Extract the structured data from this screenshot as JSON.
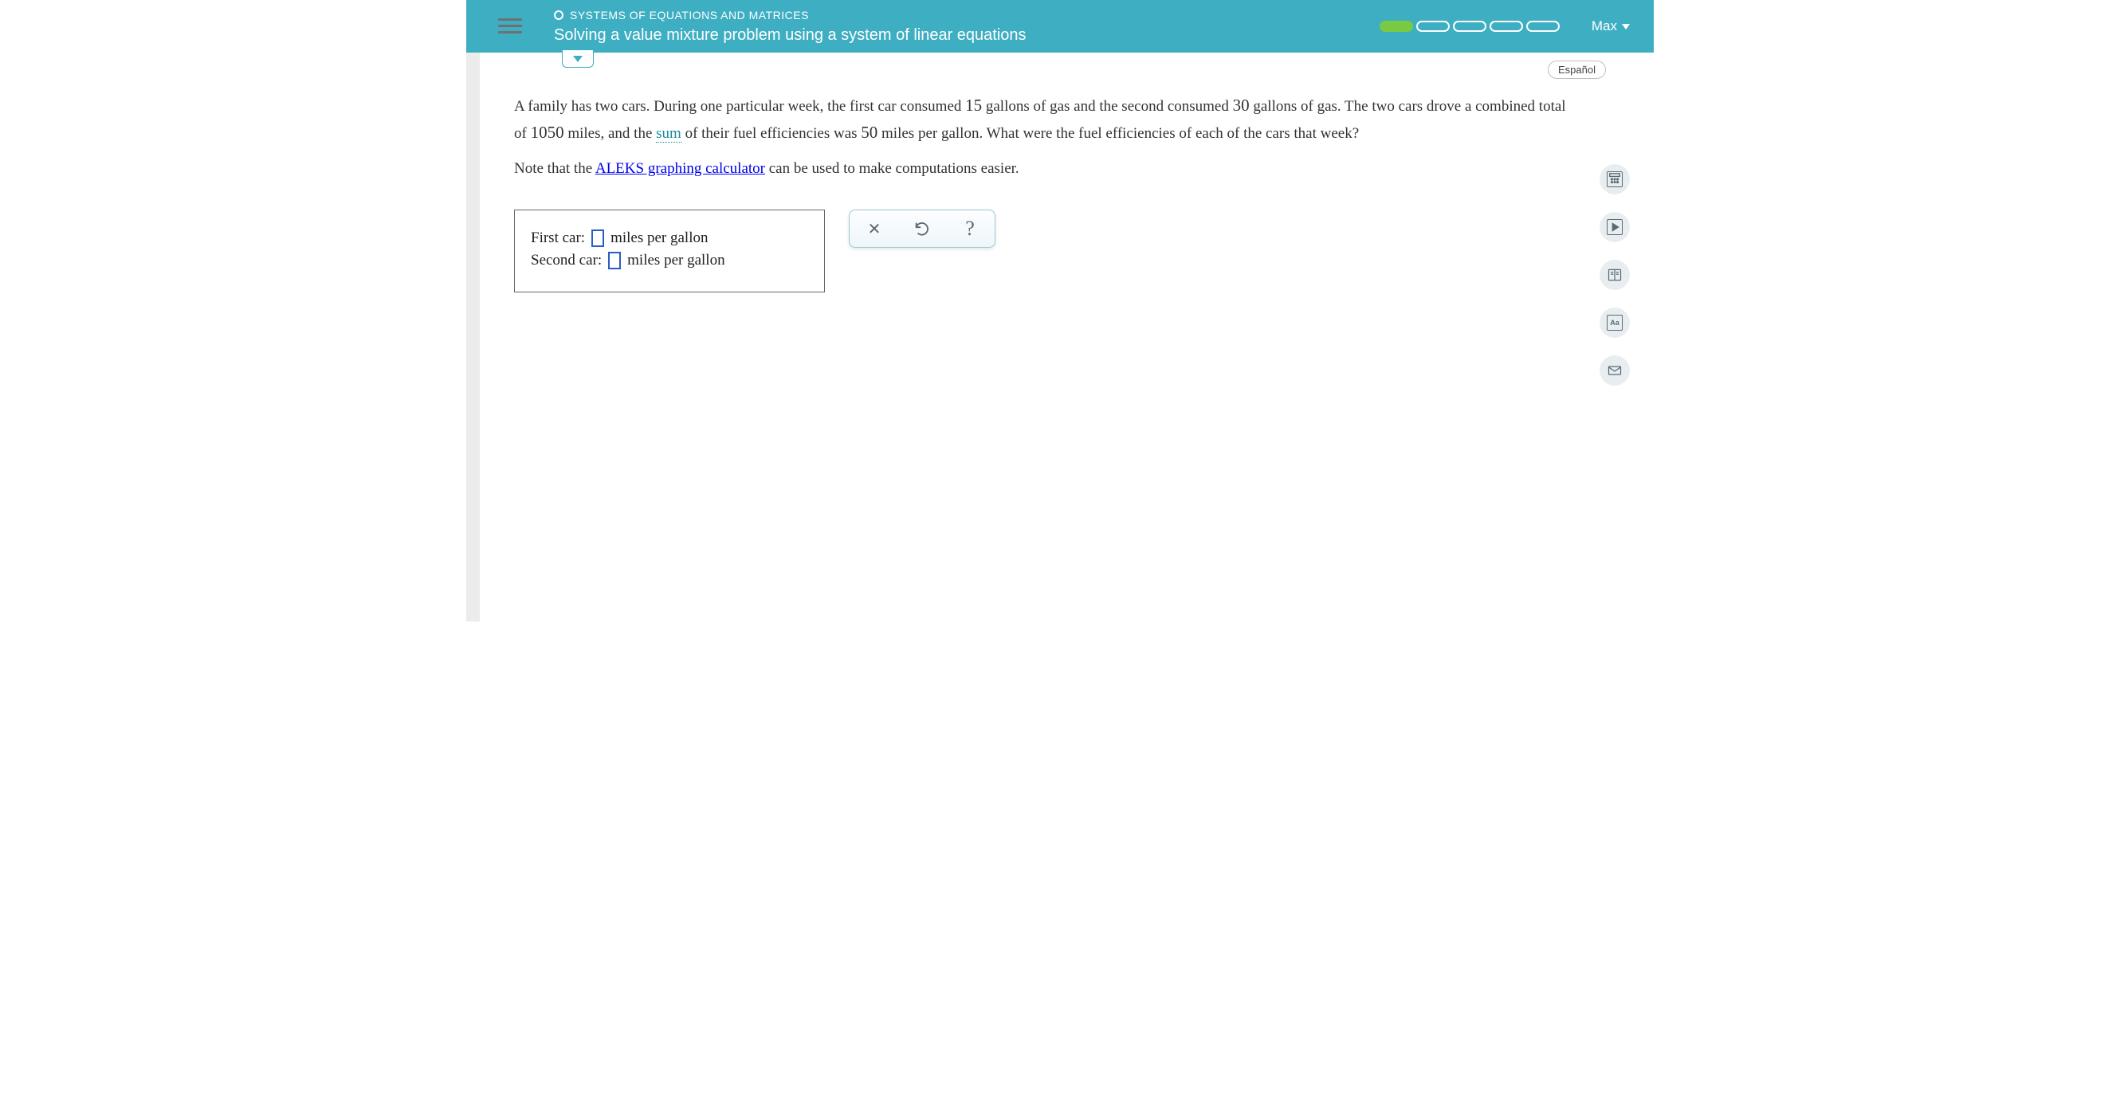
{
  "header": {
    "breadcrumb": "SYSTEMS OF EQUATIONS AND MATRICES",
    "title": "Solving a value mixture problem using a system of linear equations",
    "user_name": "Max",
    "progress_total": 5,
    "progress_filled": 1
  },
  "language_button": "Español",
  "problem": {
    "p1a": "A family has two cars. During one particular week, the first car consumed ",
    "v1": "15",
    "p1b": " gallons of gas and the second consumed ",
    "v2": "30",
    "p1c": " gallons of gas. The two cars drove a combined total of ",
    "v3": "1050",
    "p1d": " miles, and the ",
    "sum_link": "sum",
    "p1e": " of their fuel efficiencies was ",
    "v4": "50",
    "p1f": " miles per gallon. What were the fuel efficiencies of each of the cars that week?",
    "note_a": "Note that the ",
    "calc_link": "ALEKS graphing calculator",
    "note_b": " can be used to make computations easier."
  },
  "answer": {
    "line1_label": "First car:",
    "line1_unit": "miles per gallon",
    "line2_label": "Second car:",
    "line2_unit": "miles per gallon"
  },
  "tools": {
    "clear": "×",
    "undo": "↺",
    "help": "?"
  },
  "rail": {
    "calculator": "calculator",
    "video": "video",
    "textbook": "textbook",
    "glossary": "Aa",
    "message": "message"
  }
}
